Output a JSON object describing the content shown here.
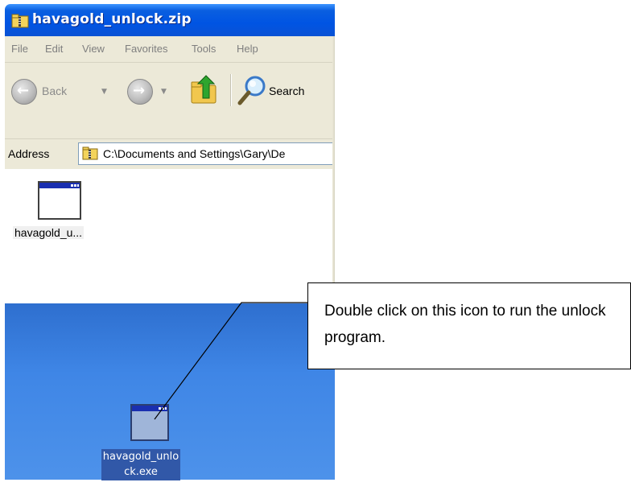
{
  "window": {
    "title": "havagold_unlock.zip",
    "menu": [
      "File",
      "Edit",
      "View",
      "Favorites",
      "Tools",
      "Help"
    ],
    "toolbar": {
      "back_label": "Back",
      "search_label": "Search"
    },
    "address": {
      "label": "Address",
      "value": "C:\\Documents and Settings\\Gary\\De"
    },
    "files": [
      {
        "name": "havagold_u...",
        "icon": "application-window-icon"
      }
    ]
  },
  "desktop": {
    "icon": "application-window-icon",
    "label_line1": "havagold_unlo",
    "label_line2": "ck.exe"
  },
  "callout": {
    "text": "Double click on this icon to run the unlock program."
  },
  "colors": {
    "title_bar": "#0054e3",
    "chrome": "#ece9d8",
    "desktop": "#3f86e6",
    "selection": "#3158a8"
  }
}
